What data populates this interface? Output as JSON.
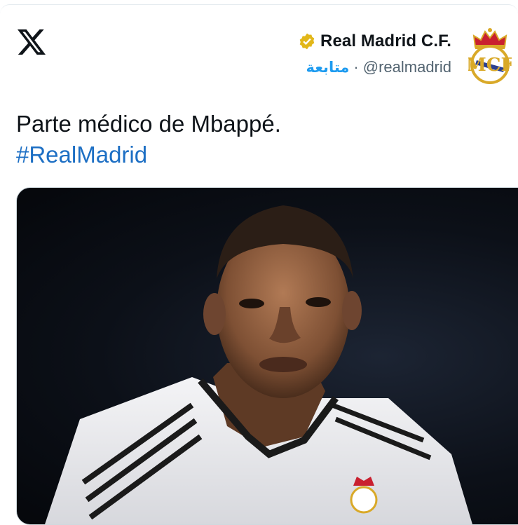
{
  "brand": {
    "logo_icon": "x-logo-icon"
  },
  "author": {
    "display_name": "Real Madrid C.F.",
    "handle": "@realmadrid",
    "separator": "·",
    "follow_label": "متابعة",
    "verified_icon": "verified-gold-badge-icon",
    "avatar_icon": "real-madrid-crest-icon"
  },
  "tweet": {
    "text": "Parte médico de Mbappé.",
    "hashtag": "#RealMadrid"
  },
  "colors": {
    "link": "#1d6fc4",
    "follow": "#1d9bf0",
    "verified_gold": "#e2b719",
    "muted": "#536471"
  }
}
